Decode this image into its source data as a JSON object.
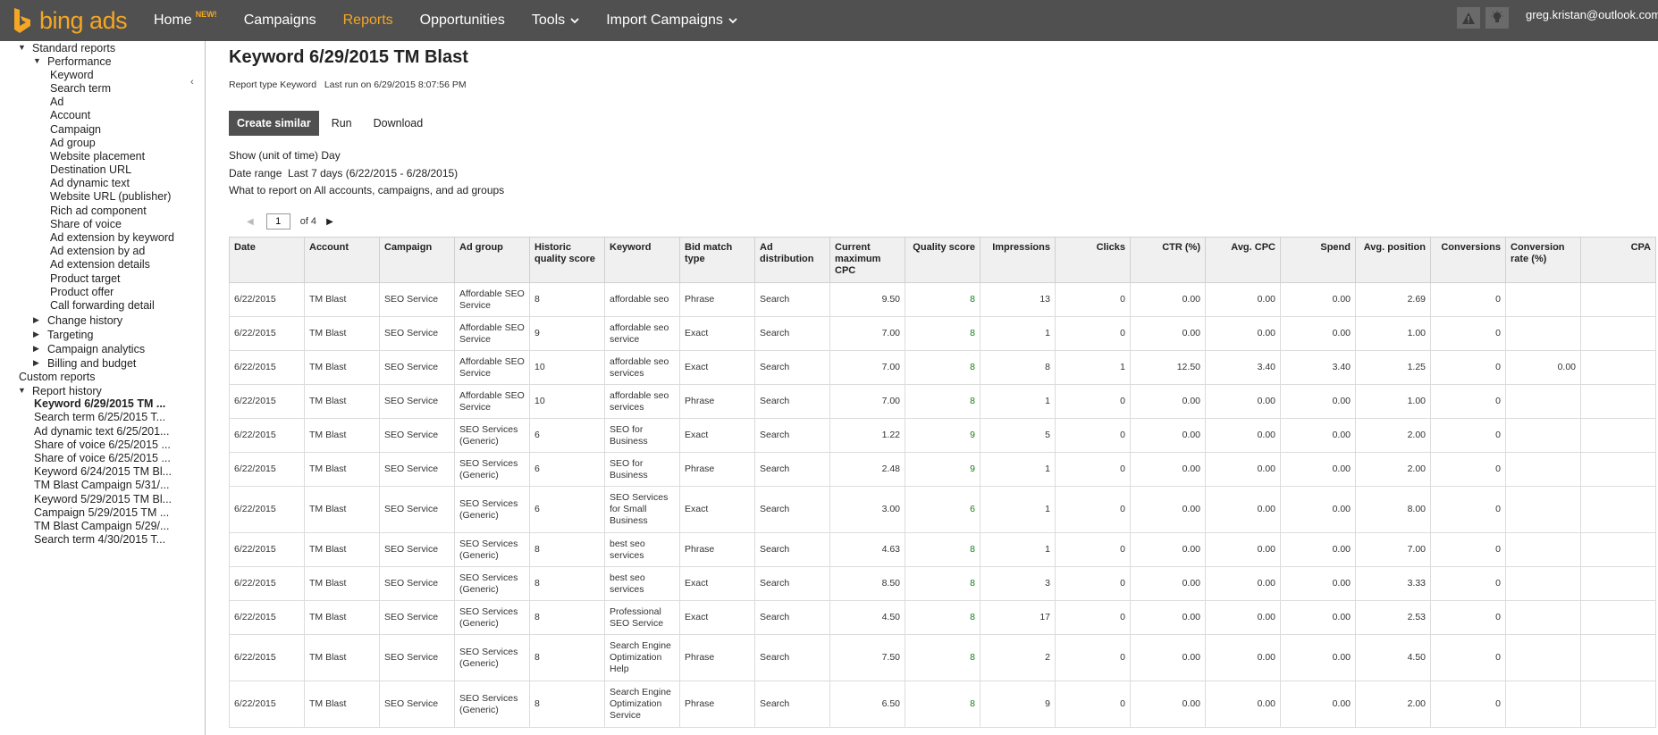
{
  "topbar": {
    "logo_text": "bing ads",
    "nav": [
      {
        "label": "Home",
        "badge": "NEW!"
      },
      {
        "label": "Campaigns"
      },
      {
        "label": "Reports",
        "active": true
      },
      {
        "label": "Opportunities"
      },
      {
        "label": "Tools",
        "dropdown": true
      },
      {
        "label": "Import Campaigns",
        "dropdown": true
      }
    ],
    "icons": [
      "warning-icon",
      "lightbulb-icon"
    ],
    "user_email": "greg.kristan@outlook.com",
    "colors": {
      "bar": "#505050",
      "accent": "#f5a623"
    }
  },
  "sidebar": {
    "items": [
      {
        "label": "Standard reports",
        "level": 0,
        "toggle": "open"
      },
      {
        "label": "Performance",
        "level": 1,
        "toggle": "open"
      },
      {
        "label": "Keyword",
        "level": 2
      },
      {
        "label": "Search term",
        "level": 2
      },
      {
        "label": "Ad",
        "level": 2
      },
      {
        "label": "Account",
        "level": 2
      },
      {
        "label": "Campaign",
        "level": 2
      },
      {
        "label": "Ad group",
        "level": 2
      },
      {
        "label": "Website placement",
        "level": 2
      },
      {
        "label": "Destination URL",
        "level": 2
      },
      {
        "label": "Ad dynamic text",
        "level": 2
      },
      {
        "label": "Website URL (publisher)",
        "level": 2
      },
      {
        "label": "Rich ad component",
        "level": 2
      },
      {
        "label": "Share of voice",
        "level": 2
      },
      {
        "label": "Ad extension by keyword",
        "level": 2
      },
      {
        "label": "Ad extension by ad",
        "level": 2
      },
      {
        "label": "Ad extension details",
        "level": 2
      },
      {
        "label": "Product target",
        "level": 2
      },
      {
        "label": "Product offer",
        "level": 2
      },
      {
        "label": "Call forwarding detail",
        "level": 2
      },
      {
        "label": "Change history",
        "level": 1,
        "toggle": "closed"
      },
      {
        "label": "Targeting",
        "level": 1,
        "toggle": "closed"
      },
      {
        "label": "Campaign analytics",
        "level": 1,
        "toggle": "closed"
      },
      {
        "label": "Billing and budget",
        "level": 1,
        "toggle": "closed"
      },
      {
        "label": "Custom reports",
        "level": 0
      },
      {
        "label": "Report history",
        "level": 0,
        "toggle": "open"
      },
      {
        "label": "Keyword 6/29/2015 TM ...",
        "level": 3,
        "bold": true
      },
      {
        "label": "Search term 6/25/2015 T...",
        "level": 3
      },
      {
        "label": "Ad dynamic text 6/25/201...",
        "level": 3
      },
      {
        "label": "Share of voice 6/25/2015 ...",
        "level": 3
      },
      {
        "label": "Share of voice 6/25/2015 ...",
        "level": 3
      },
      {
        "label": "Keyword 6/24/2015 TM Bl...",
        "level": 3
      },
      {
        "label": "TM Blast Campaign 5/31/...",
        "level": 3
      },
      {
        "label": "Keyword 5/29/2015 TM Bl...",
        "level": 3
      },
      {
        "label": "Campaign 5/29/2015 TM ...",
        "level": 3
      },
      {
        "label": "TM Blast Campaign 5/29/...",
        "level": 3
      },
      {
        "label": "Search term 4/30/2015 T...",
        "level": 3
      }
    ]
  },
  "main": {
    "title": "Keyword 6/29/2015 TM Blast",
    "report_type_label": "Report type",
    "report_type": "Keyword",
    "last_run_label": "Last run on",
    "last_run": "6/29/2015 8:07:56 PM",
    "buttons": {
      "create_similar": "Create similar",
      "run": "Run",
      "download": "Download"
    },
    "info": {
      "show_label": "Show (unit of time)",
      "show_value": "Day",
      "date_range_label": "Date range",
      "date_range_value": "Last 7 days (6/22/2015 - 6/28/2015)",
      "what_label": "What to report on",
      "what_value": "All accounts, campaigns, and ad groups"
    },
    "pager": {
      "page": "1",
      "of_text": "of 4"
    },
    "table": {
      "columns": [
        "Date",
        "Account",
        "Campaign",
        "Ad group",
        "Historic quality score",
        "Keyword",
        "Bid match type",
        "Ad distribution",
        "Current maximum CPC",
        "Quality score",
        "Impressions",
        "Clicks",
        "CTR (%)",
        "Avg. CPC",
        "Spend",
        "Avg. position",
        "Conversions",
        "Conversion rate (%)",
        "CPA"
      ],
      "rows": [
        [
          "6/22/2015",
          "TM Blast",
          "SEO Service",
          "Affordable SEO Service",
          "8",
          "affordable seo",
          "Phrase",
          "Search",
          "9.50",
          "8",
          "13",
          "0",
          "0.00",
          "0.00",
          "0.00",
          "2.69",
          "0",
          "",
          ""
        ],
        [
          "6/22/2015",
          "TM Blast",
          "SEO Service",
          "Affordable SEO Service",
          "9",
          "affordable seo service",
          "Exact",
          "Search",
          "7.00",
          "8",
          "1",
          "0",
          "0.00",
          "0.00",
          "0.00",
          "1.00",
          "0",
          "",
          ""
        ],
        [
          "6/22/2015",
          "TM Blast",
          "SEO Service",
          "Affordable SEO Service",
          "10",
          "affordable seo services",
          "Exact",
          "Search",
          "7.00",
          "8",
          "8",
          "1",
          "12.50",
          "3.40",
          "3.40",
          "1.25",
          "0",
          "0.00",
          ""
        ],
        [
          "6/22/2015",
          "TM Blast",
          "SEO Service",
          "Affordable SEO Service",
          "10",
          "affordable seo services",
          "Phrase",
          "Search",
          "7.00",
          "8",
          "1",
          "0",
          "0.00",
          "0.00",
          "0.00",
          "1.00",
          "0",
          "",
          ""
        ],
        [
          "6/22/2015",
          "TM Blast",
          "SEO Service",
          "SEO Services (Generic)",
          "6",
          "SEO for Business",
          "Exact",
          "Search",
          "1.22",
          "9",
          "5",
          "0",
          "0.00",
          "0.00",
          "0.00",
          "2.00",
          "0",
          "",
          ""
        ],
        [
          "6/22/2015",
          "TM Blast",
          "SEO Service",
          "SEO Services (Generic)",
          "6",
          "SEO for Business",
          "Phrase",
          "Search",
          "2.48",
          "9",
          "1",
          "0",
          "0.00",
          "0.00",
          "0.00",
          "2.00",
          "0",
          "",
          ""
        ],
        [
          "6/22/2015",
          "TM Blast",
          "SEO Service",
          "SEO Services (Generic)",
          "6",
          "SEO Services for Small Business",
          "Exact",
          "Search",
          "3.00",
          "6",
          "1",
          "0",
          "0.00",
          "0.00",
          "0.00",
          "8.00",
          "0",
          "",
          ""
        ],
        [
          "6/22/2015",
          "TM Blast",
          "SEO Service",
          "SEO Services (Generic)",
          "8",
          "best seo services",
          "Phrase",
          "Search",
          "4.63",
          "8",
          "1",
          "0",
          "0.00",
          "0.00",
          "0.00",
          "7.00",
          "0",
          "",
          ""
        ],
        [
          "6/22/2015",
          "TM Blast",
          "SEO Service",
          "SEO Services (Generic)",
          "8",
          "best seo services",
          "Exact",
          "Search",
          "8.50",
          "8",
          "3",
          "0",
          "0.00",
          "0.00",
          "0.00",
          "3.33",
          "0",
          "",
          ""
        ],
        [
          "6/22/2015",
          "TM Blast",
          "SEO Service",
          "SEO Services (Generic)",
          "8",
          "Professional SEO Service",
          "Exact",
          "Search",
          "4.50",
          "8",
          "17",
          "0",
          "0.00",
          "0.00",
          "0.00",
          "2.53",
          "0",
          "",
          ""
        ],
        [
          "6/22/2015",
          "TM Blast",
          "SEO Service",
          "SEO Services (Generic)",
          "8",
          "Search Engine Optimization Help",
          "Phrase",
          "Search",
          "7.50",
          "8",
          "2",
          "0",
          "0.00",
          "0.00",
          "0.00",
          "4.50",
          "0",
          "",
          ""
        ],
        [
          "6/22/2015",
          "TM Blast",
          "SEO Service",
          "SEO Services (Generic)",
          "8",
          "Search Engine Optimization Service",
          "Phrase",
          "Search",
          "6.50",
          "8",
          "9",
          "0",
          "0.00",
          "0.00",
          "0.00",
          "2.00",
          "0",
          "",
          ""
        ]
      ]
    }
  }
}
